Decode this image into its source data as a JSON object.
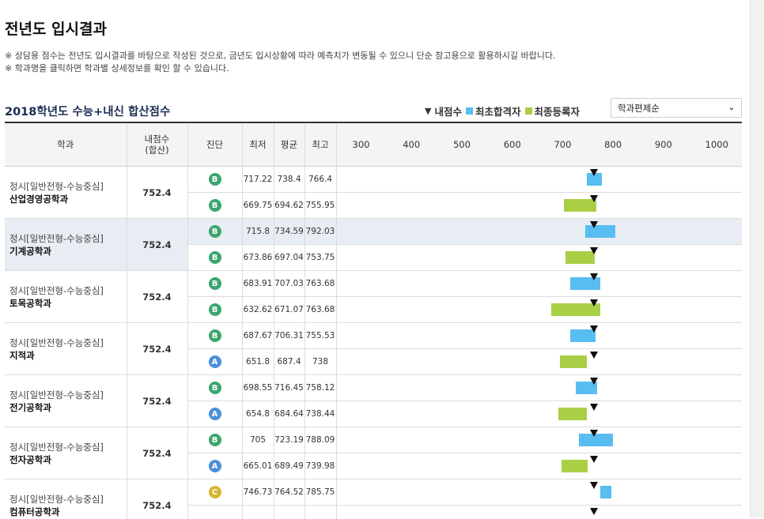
{
  "page_title": "전년도 입시결과",
  "notices": [
    "※ 상담용 점수는 전년도 입시결과를 바탕으로 작성된 것으로, 금년도 입시상황에 따라 예측치가 변동될 수 있으니 단순 참고용으로 활용하시길 바랍니다.",
    "※ 학과명을 클릭하면 학과별 상세정보를 확인 할 수 있습니다."
  ],
  "section_title": "2018학년도 수능+내신 합산점수",
  "legend": {
    "my_score": "내점수",
    "first_pass": "최초합격자",
    "final_reg": "최종등록자"
  },
  "colors": {
    "first_pass": "#58bdf0",
    "final_reg": "#a9cf45",
    "badge_A": "#4a90d9",
    "badge_B": "#3aa66e",
    "badge_C": "#d6b531",
    "marker": "#111111"
  },
  "sort": {
    "selected": "학과편제순"
  },
  "headers": {
    "dept": "학과",
    "my_score": "내점수\n(합산)",
    "diag": "진단",
    "min": "최저",
    "avg": "평균",
    "max": "최고"
  },
  "scale": [
    300,
    400,
    500,
    600,
    700,
    800,
    900,
    1000
  ],
  "departments": [
    {
      "category": "정시[일반전형-수능중심]",
      "name": "산업경영공학과",
      "my_score": "752.4",
      "rows": [
        {
          "type": "first_pass",
          "diag": "B",
          "min": "717.22",
          "avg": "738.4",
          "max": "766.4"
        },
        {
          "type": "final_reg",
          "diag": "B",
          "min": "669.75",
          "avg": "694.62",
          "max": "755.95"
        }
      ]
    },
    {
      "category": "정시[일반전형-수능중심]",
      "name": "기계공학과",
      "my_score": "752.4",
      "rows": [
        {
          "type": "first_pass",
          "diag": "B",
          "min": "715.8",
          "avg": "734.59",
          "max": "792.03",
          "highlight": true
        },
        {
          "type": "final_reg",
          "diag": "B",
          "min": "673.86",
          "avg": "697.04",
          "max": "753.75"
        }
      ]
    },
    {
      "category": "정시[일반전형-수능중심]",
      "name": "토목공학과",
      "my_score": "752.4",
      "rows": [
        {
          "type": "first_pass",
          "diag": "B",
          "min": "683.91",
          "avg": "707.03",
          "max": "763.68"
        },
        {
          "type": "final_reg",
          "diag": "B",
          "min": "632.62",
          "avg": "671.07",
          "max": "763.68"
        }
      ]
    },
    {
      "category": "정시[일반전형-수능중심]",
      "name": "지적과",
      "my_score": "752.4",
      "rows": [
        {
          "type": "first_pass",
          "diag": "B",
          "min": "687.67",
          "avg": "706.31",
          "max": "755.53"
        },
        {
          "type": "final_reg",
          "diag": "A",
          "min": "651.8",
          "avg": "687.4",
          "max": "738"
        }
      ]
    },
    {
      "category": "정시[일반전형-수능중심]",
      "name": "전기공학과",
      "my_score": "752.4",
      "rows": [
        {
          "type": "first_pass",
          "diag": "B",
          "min": "698.55",
          "avg": "716.45",
          "max": "758.12"
        },
        {
          "type": "final_reg",
          "diag": "A",
          "min": "654.8",
          "avg": "684.64",
          "max": "738.44"
        }
      ]
    },
    {
      "category": "정시[일반전형-수능중심]",
      "name": "전자공학과",
      "my_score": "752.4",
      "rows": [
        {
          "type": "first_pass",
          "diag": "B",
          "min": "705",
          "avg": "723.19",
          "max": "788.09"
        },
        {
          "type": "final_reg",
          "diag": "A",
          "min": "665.01",
          "avg": "689.49",
          "max": "739.98"
        }
      ]
    },
    {
      "category": "정시[일반전형-수능중심]",
      "name": "컴퓨터공학과",
      "my_score": "752.4",
      "rows": [
        {
          "type": "first_pass",
          "diag": "C",
          "min": "746.73",
          "avg": "764.52",
          "max": "785.75"
        },
        {
          "type": "final_reg",
          "diag": "",
          "min": "",
          "avg": "",
          "max": ""
        }
      ]
    }
  ]
}
